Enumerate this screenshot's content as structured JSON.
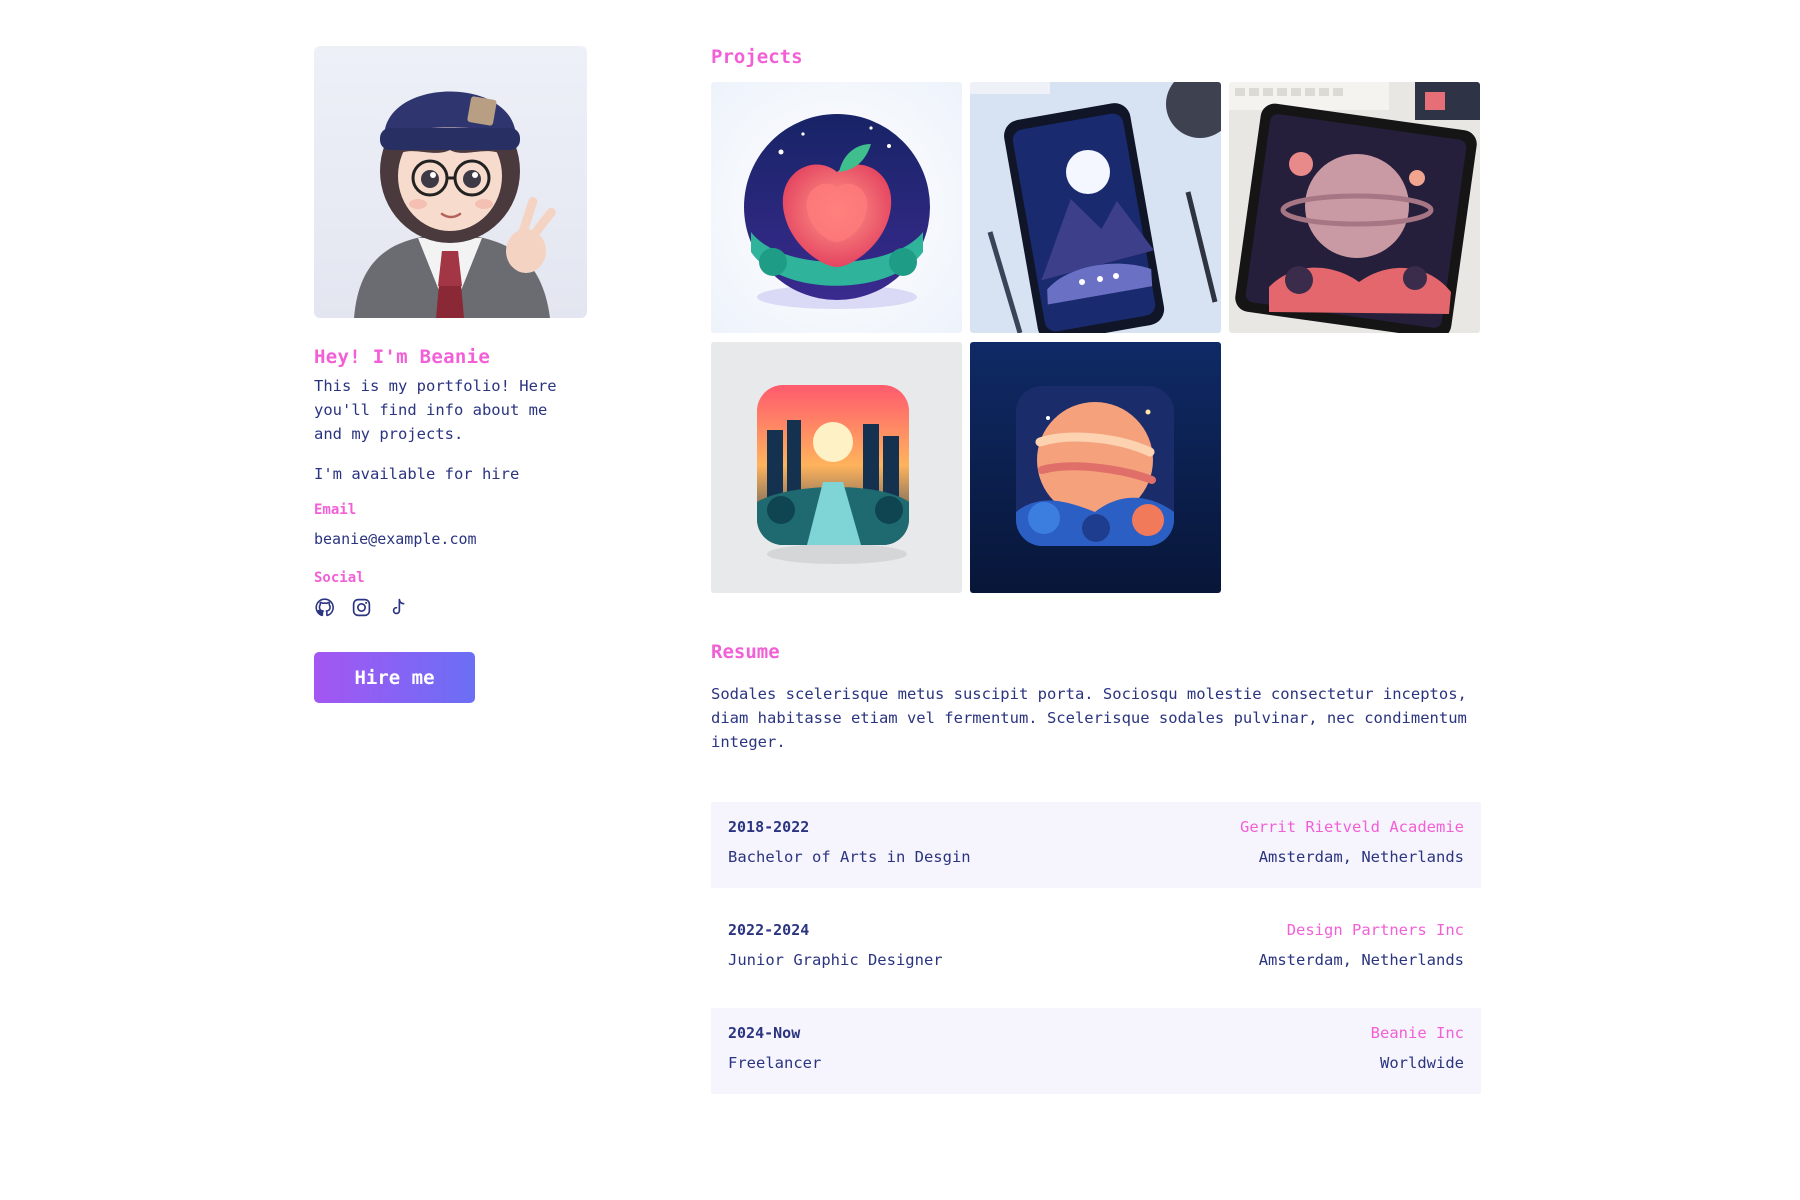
{
  "colors": {
    "accent_pink": "#f25fd6",
    "text_navy": "#2b3480",
    "button_gradient_start": "#a456f2",
    "button_gradient_end": "#6b6ff5",
    "row_shade": "#f6f5fd"
  },
  "profile": {
    "avatar_icon": "avatar-illustration",
    "greeting": "Hey! I'm Beanie",
    "intro": "This is my portfolio! Here you'll find info about me and my projects.",
    "availability": "I'm available for hire",
    "email_label": "Email",
    "email": "beanie@example.com",
    "social_label": "Social",
    "socials": [
      "github-icon",
      "instagram-icon",
      "tiktok-icon"
    ],
    "hire_button": "Hire me"
  },
  "projects": {
    "title": "Projects",
    "items": [
      {
        "icon": "apple-artwork"
      },
      {
        "icon": "phone-mountain-artwork"
      },
      {
        "icon": "tablet-planet-artwork"
      },
      {
        "icon": "sunset-city-app-icon"
      },
      {
        "icon": "planet-app-icon"
      }
    ]
  },
  "resume": {
    "title": "Resume",
    "summary": "Sodales scelerisque metus suscipit porta. Sociosqu molestie consectetur inceptos, diam habitasse etiam vel fermentum. Scelerisque sodales pulvinar, nec condimentum integer.",
    "entries": [
      {
        "years": "2018-2022",
        "role": "Bachelor of Arts in Desgin",
        "org": "Gerrit Rietveld Academie",
        "location": "Amsterdam, Netherlands"
      },
      {
        "years": "2022-2024",
        "role": "Junior Graphic Designer",
        "org": "Design Partners Inc",
        "location": "Amsterdam, Netherlands"
      },
      {
        "years": "2024-Now",
        "role": "Freelancer",
        "org": "Beanie Inc",
        "location": "Worldwide"
      }
    ]
  }
}
